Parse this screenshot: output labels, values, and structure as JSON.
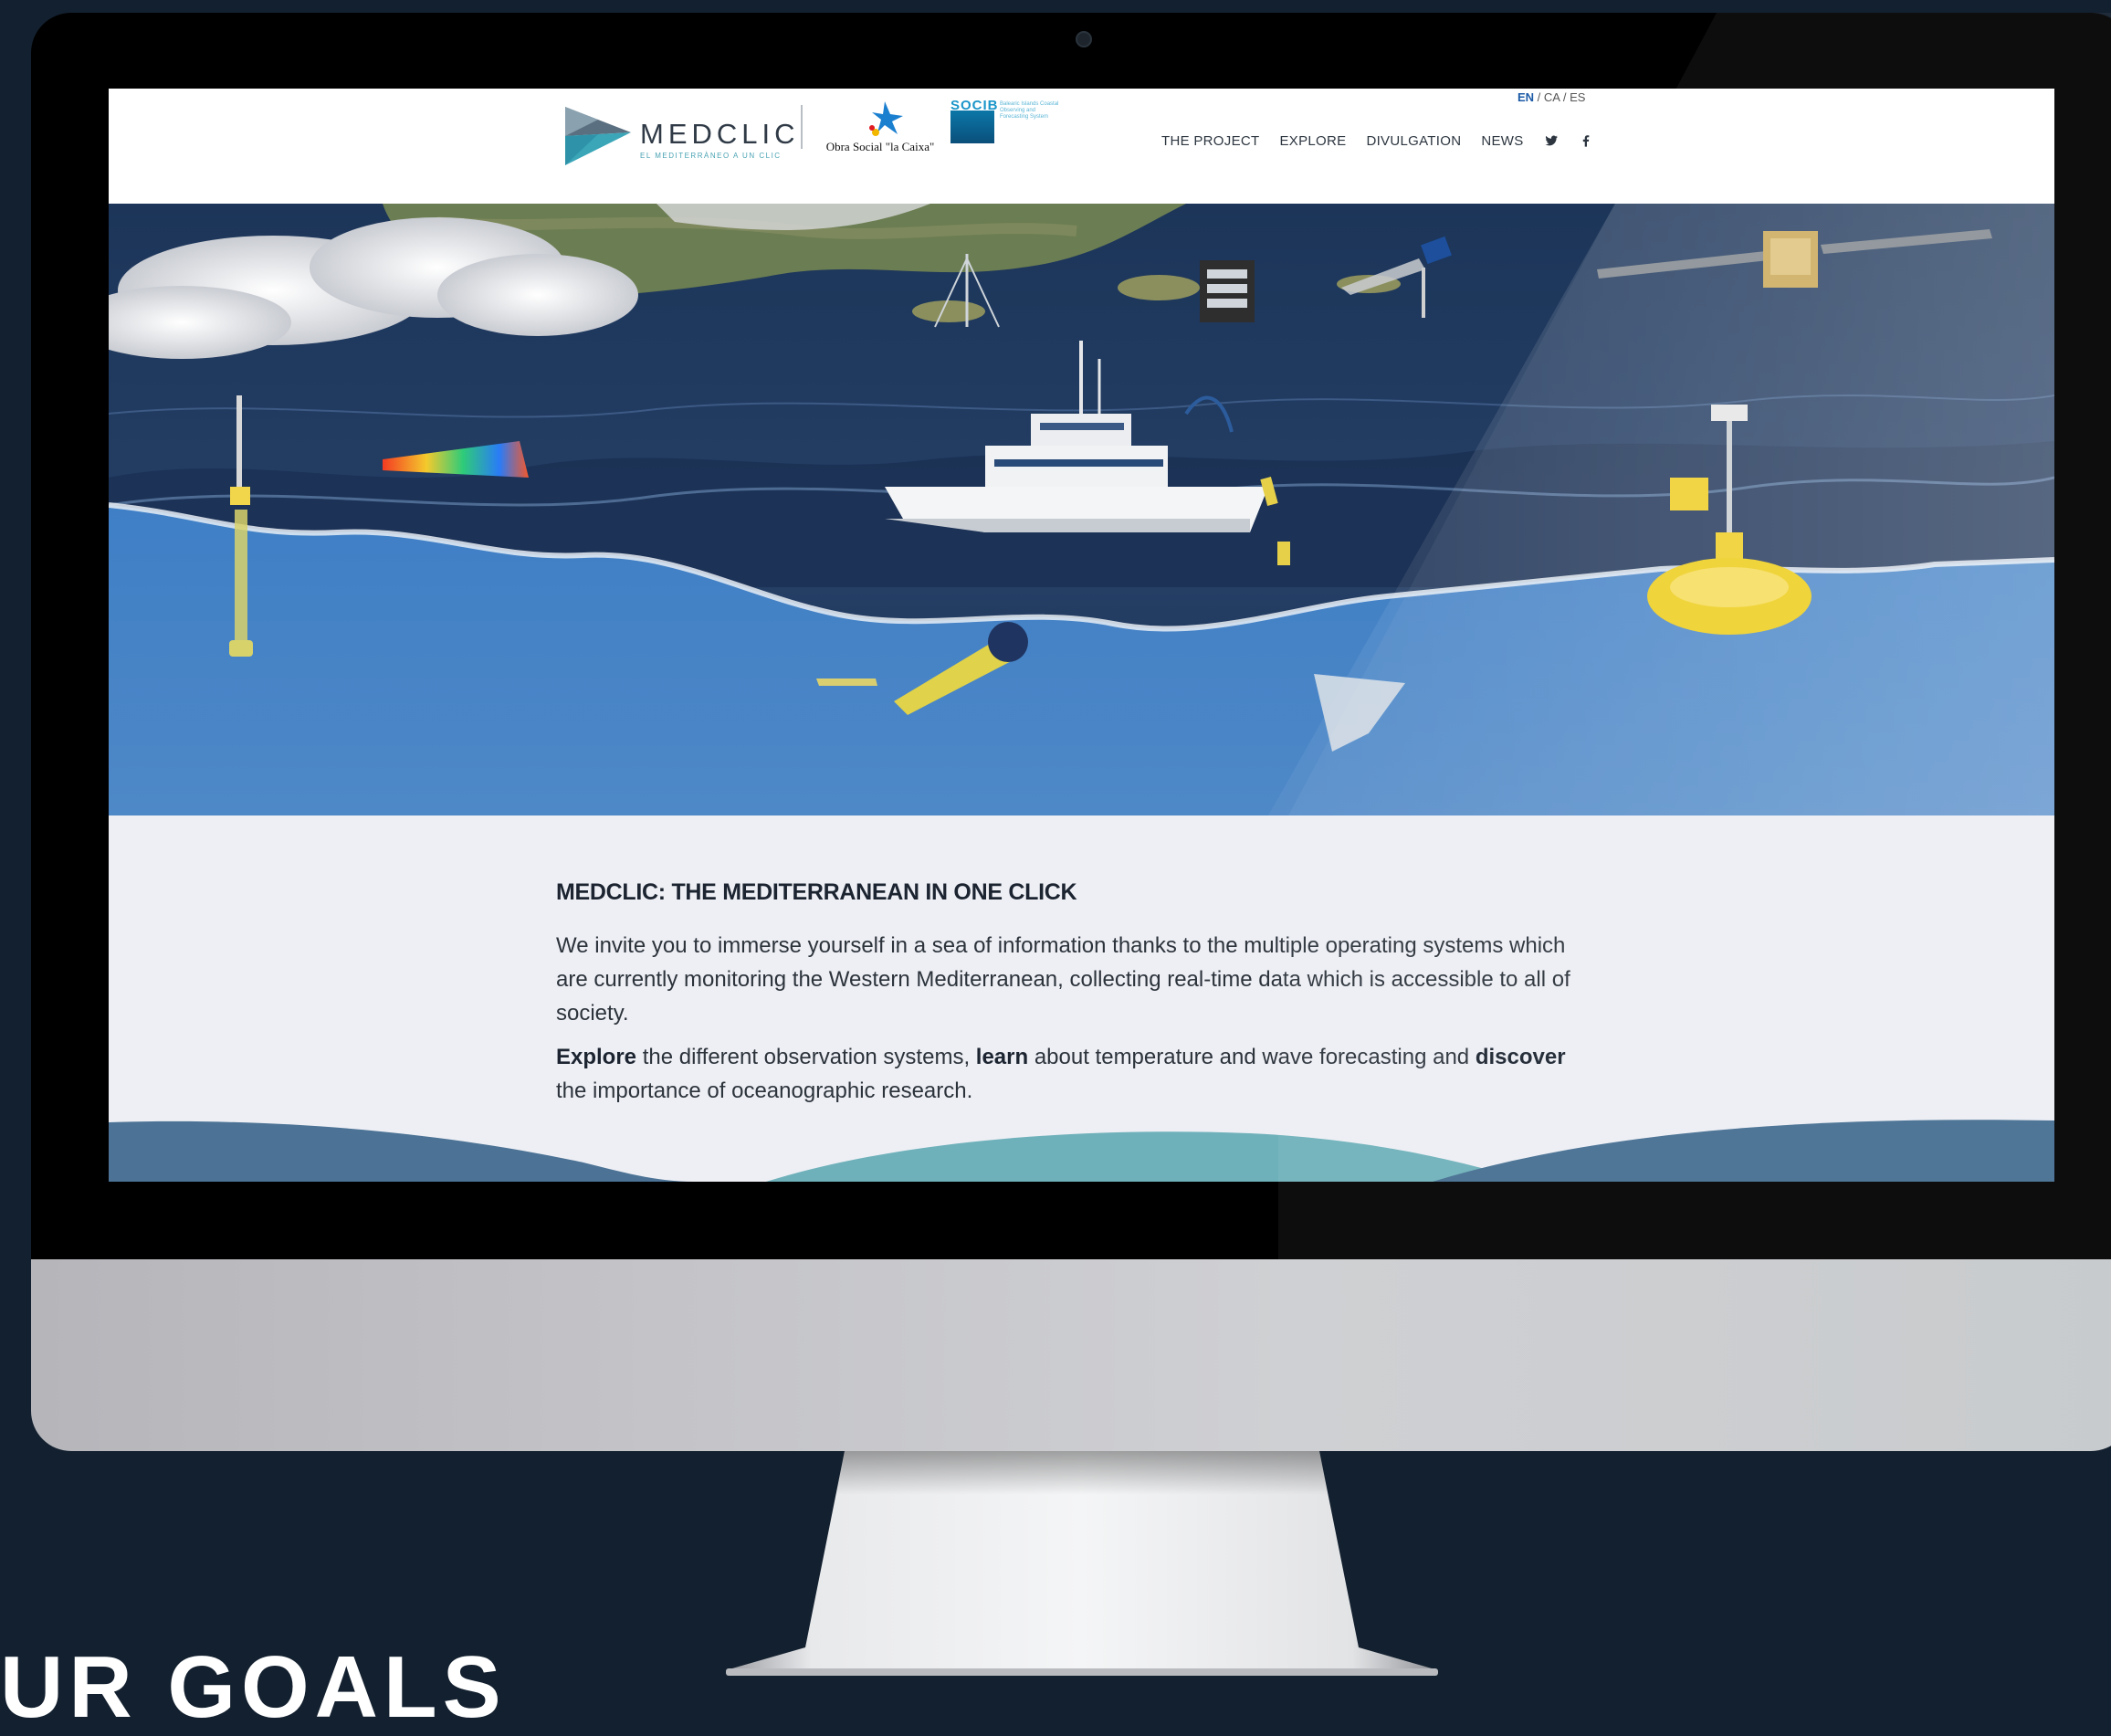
{
  "header": {
    "logo_word": "MEDCLIC",
    "logo_tagline": "EL MEDITERRÀNEO A UN CLIC",
    "partner_caixa": "Obra Social \"la Caixa\"",
    "partner_socib": "SOCIB",
    "partner_socib_desc": "Balearic Islands Coastal Observing and Forecasting System",
    "lang": {
      "active": "EN",
      "sep": " / ",
      "others": "CA / ES"
    },
    "nav": [
      {
        "label": "THE PROJECT"
      },
      {
        "label": "EXPLORE"
      },
      {
        "label": "DIVULGATION"
      },
      {
        "label": "NEWS"
      }
    ],
    "social_icons": [
      "twitter-icon",
      "facebook-icon"
    ]
  },
  "intro": {
    "title": "MEDCLIC: THE MEDITERRANEAN IN ONE CLICK",
    "paragraph1": "We invite you to immerse yourself in a sea of information thanks to the multiple operating systems which are currently monitoring the Western Mediterranean, collecting real-time data which is accessible to all of society.",
    "p2_explore": "Explore",
    "p2_a": " the different observation systems, ",
    "p2_learn": "learn",
    "p2_b": " about temperature and wave forecasting and ",
    "p2_discover": "discover",
    "p2_c": " the importance of oceanographic research."
  },
  "footer_heading": "UR GOALS",
  "colors": {
    "background": "#13202f",
    "accent": "#1b5aa6",
    "teal": "#4aa3b3"
  }
}
